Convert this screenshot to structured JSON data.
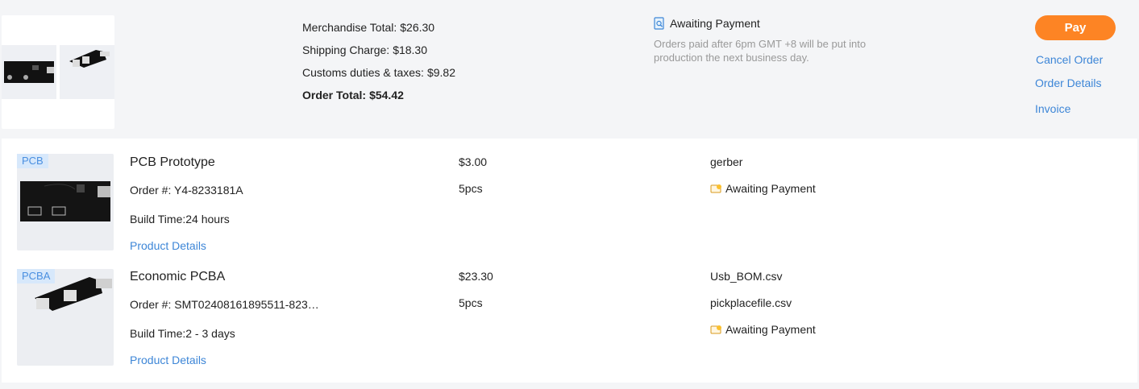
{
  "summary": {
    "merchandise_label": "Merchandise Total:",
    "merchandise_value": "$26.30",
    "shipping_label": "Shipping Charge:",
    "shipping_value": "$18.30",
    "customs_label": "Customs duties & taxes:",
    "customs_value": "$9.82",
    "order_total_label": "Order Total:",
    "order_total_value": "$54.42"
  },
  "status": {
    "label": "Awaiting Payment",
    "note": "Orders paid after 6pm GMT +8 will be put into production the next business day.",
    "icon": "search-doc-icon"
  },
  "actions": {
    "pay": "Pay",
    "cancel": "Cancel Order",
    "details": "Order Details",
    "invoice": "Invoice"
  },
  "items": [
    {
      "tag": "PCB",
      "name": "PCB Prototype",
      "order": "Order #: Y4-8233181A",
      "build": "Build Time:24 hours",
      "link": "Product Details",
      "price": "$3.00",
      "qty": "5pcs",
      "files": [
        "gerber"
      ],
      "status": "Awaiting Payment"
    },
    {
      "tag": "PCBA",
      "name": "Economic PCBA",
      "order": "Order #: SMT02408161895511-823…",
      "build": "Build Time:2 - 3 days",
      "link": "Product Details",
      "price": "$23.30",
      "qty": "5pcs",
      "files": [
        "Usb_BOM.csv",
        "pickplacefile.csv"
      ],
      "status": "Awaiting Payment"
    }
  ],
  "colors": {
    "accent": "#fd8424",
    "link": "#3d86d7",
    "tag_bg": "#d7e8fb",
    "tag_text": "#4a8fe0",
    "muted": "#999999"
  }
}
